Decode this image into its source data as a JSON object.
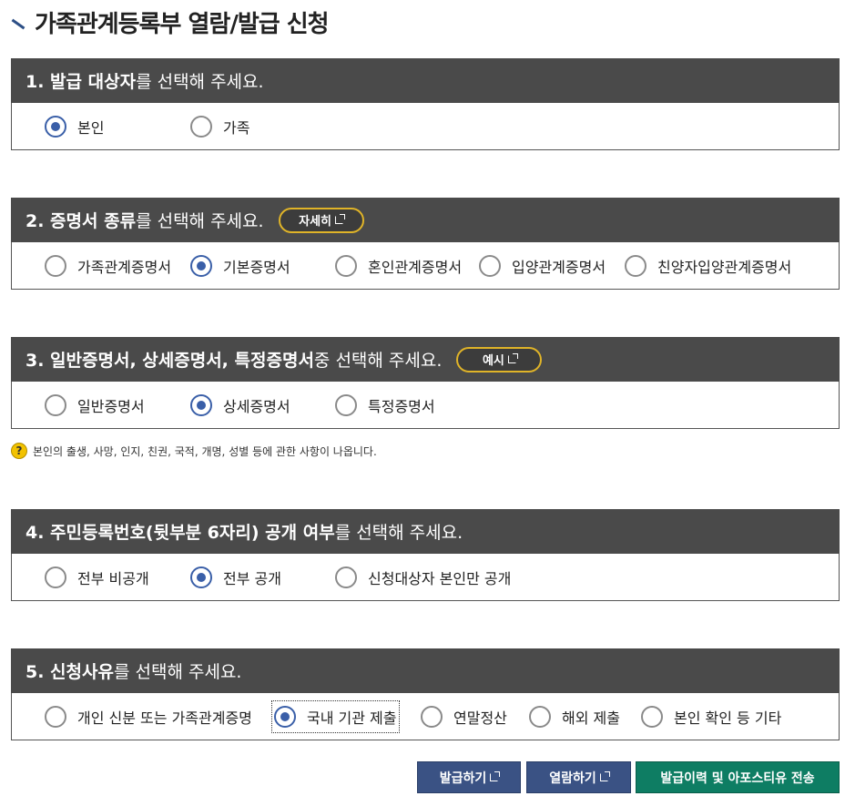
{
  "title": "가족관계등록부 열람/발급 신청",
  "sections": [
    {
      "bold": "1. 발급 대상자",
      "rest": "를 선택해 주세요.",
      "options": [
        "본인",
        "가족"
      ],
      "selected": "본인"
    },
    {
      "bold": "2. 증명서 종류",
      "rest": "를 선택해 주세요.",
      "pill": "자세히",
      "options": [
        "가족관계증명서",
        "기본증명서",
        "혼인관계증명서",
        "입양관계증명서",
        "친양자입양관계증명서"
      ],
      "selected": "기본증명서"
    },
    {
      "bold": "3. 일반증명서, 상세증명서, 특정증명서",
      "rest": " 중 선택해 주세요.",
      "pill": "예시",
      "options": [
        "일반증명서",
        "상세증명서",
        "특정증명서"
      ],
      "selected": "상세증명서"
    },
    {
      "bold": "4. 주민등록번호(뒷부분 6자리) 공개 여부",
      "rest": "를 선택해 주세요.",
      "options": [
        "전부 비공개",
        "전부 공개",
        "신청대상자 본인만 공개"
      ],
      "selected": "전부 공개"
    },
    {
      "bold": "5. 신청사유",
      "rest": "를 선택해 주세요.",
      "options": [
        "개인 신분 또는 가족관계증명",
        "국내 기관 제출",
        "연말정산",
        "해외 제출",
        "본인 확인 등 기타"
      ],
      "selected": "국내 기관 제출"
    }
  ],
  "note": {
    "icon": "question-icon",
    "text": "본인의 출생, 사망, 인지, 친권, 국적, 개명, 성별 등에 관한 사항이 나옵니다."
  },
  "buttons": {
    "issue": "발급하기",
    "view": "열람하기",
    "send": "발급이력 및 아포스티유 전송"
  },
  "colors": {
    "header": "#4a4a4a",
    "radio_selected": "#3a5fa8",
    "pill_border": "#e0b428",
    "btn_blue": "#3a5284",
    "btn_green": "#0e7d63"
  }
}
